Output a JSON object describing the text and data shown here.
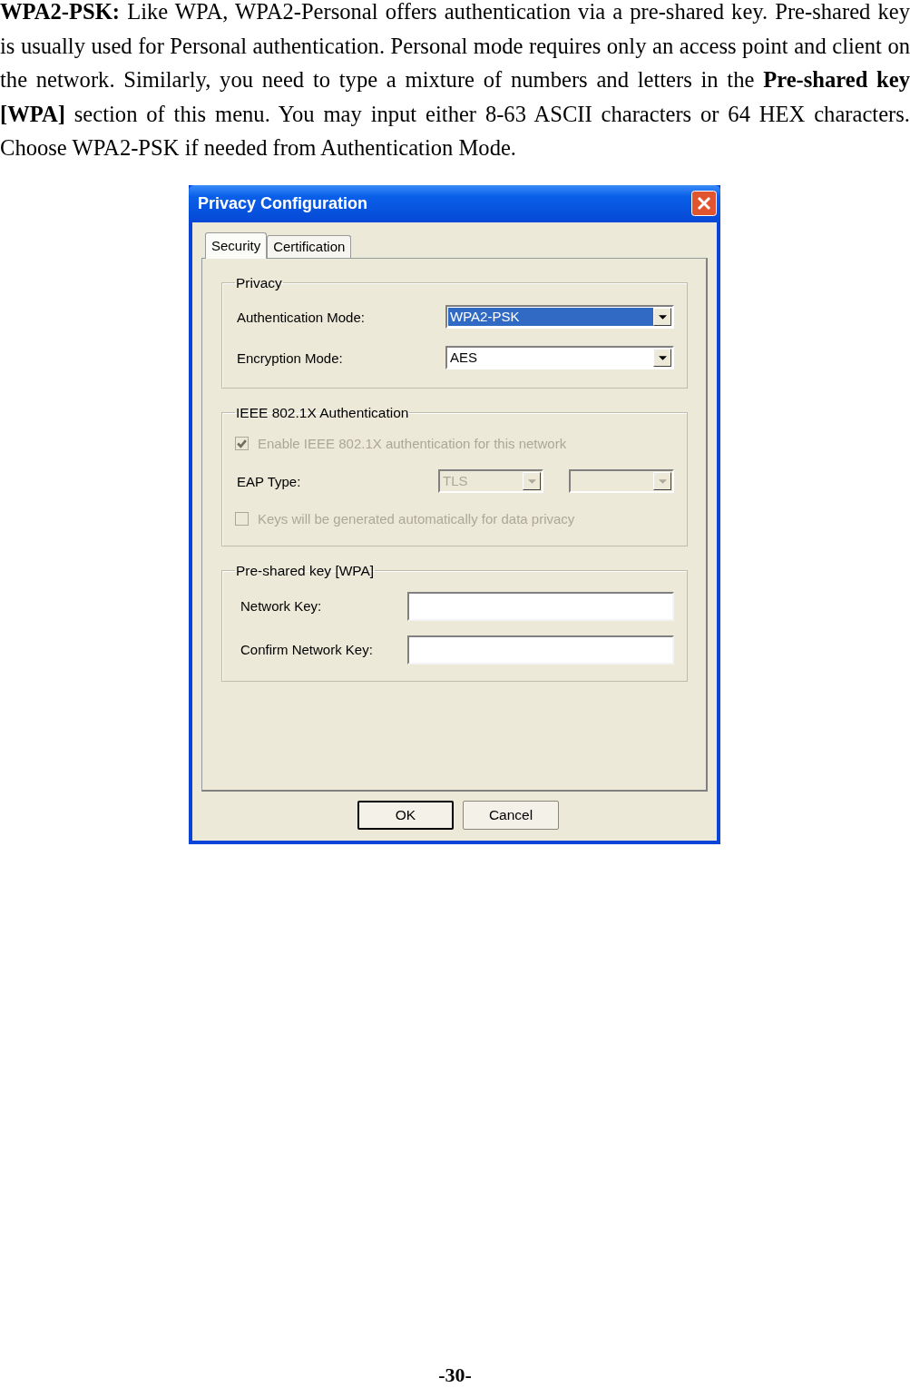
{
  "document": {
    "paragraph": "**WPA2-PSK:** Like WPA, WPA2-Personal offers authentication via a pre-shared key. Pre-shared key is usually used for Personal authentication. Personal mode requires only an access point and client on the network. Similarly, you need to type a mixture of numbers and letters in the **Pre-shared key [WPA]** section of this menu. You may input either 8-63 ASCII characters or 64 HEX characters. Choose WPA2-PSK if needed from Authentication Mode.",
    "page_number": "-30-"
  },
  "window": {
    "title": "Privacy Configuration"
  },
  "tabs": [
    {
      "label": "Security",
      "selected": true
    },
    {
      "label": "Certification",
      "selected": false
    }
  ],
  "groups": [
    {
      "title": "Privacy",
      "rows": [
        {
          "kind": "dropdown",
          "label": "Authentication Mode:",
          "value": "WPA2-PSK",
          "highlighted": true,
          "disabled": false
        },
        {
          "kind": "dropdown",
          "label": "Encryption Mode:",
          "value": "AES",
          "highlighted": false,
          "disabled": false
        }
      ]
    },
    {
      "title": "IEEE 802.1X Authentication",
      "rows": [
        {
          "kind": "checkbox",
          "label": "Enable IEEE 802.1X authentication for this network",
          "checked": true,
          "disabled": true
        },
        {
          "kind": "dual-dropdown",
          "label": "EAP Type:",
          "dropdowns": [
            {
              "value": "TLS",
              "disabled": true
            },
            {
              "disabled": true
            }
          ]
        },
        {
          "kind": "checkbox",
          "label": "Keys will be generated automatically for data privacy",
          "checked": false,
          "disabled": true
        }
      ]
    },
    {
      "title": "Pre-shared key [WPA]",
      "rows": [
        {
          "kind": "input",
          "label": "Network Key:"
        },
        {
          "kind": "input",
          "label": "Confirm Network Key:"
        }
      ]
    }
  ],
  "buttons": [
    {
      "label": "OK",
      "default": true
    },
    {
      "label": "Cancel",
      "default": false
    }
  ]
}
